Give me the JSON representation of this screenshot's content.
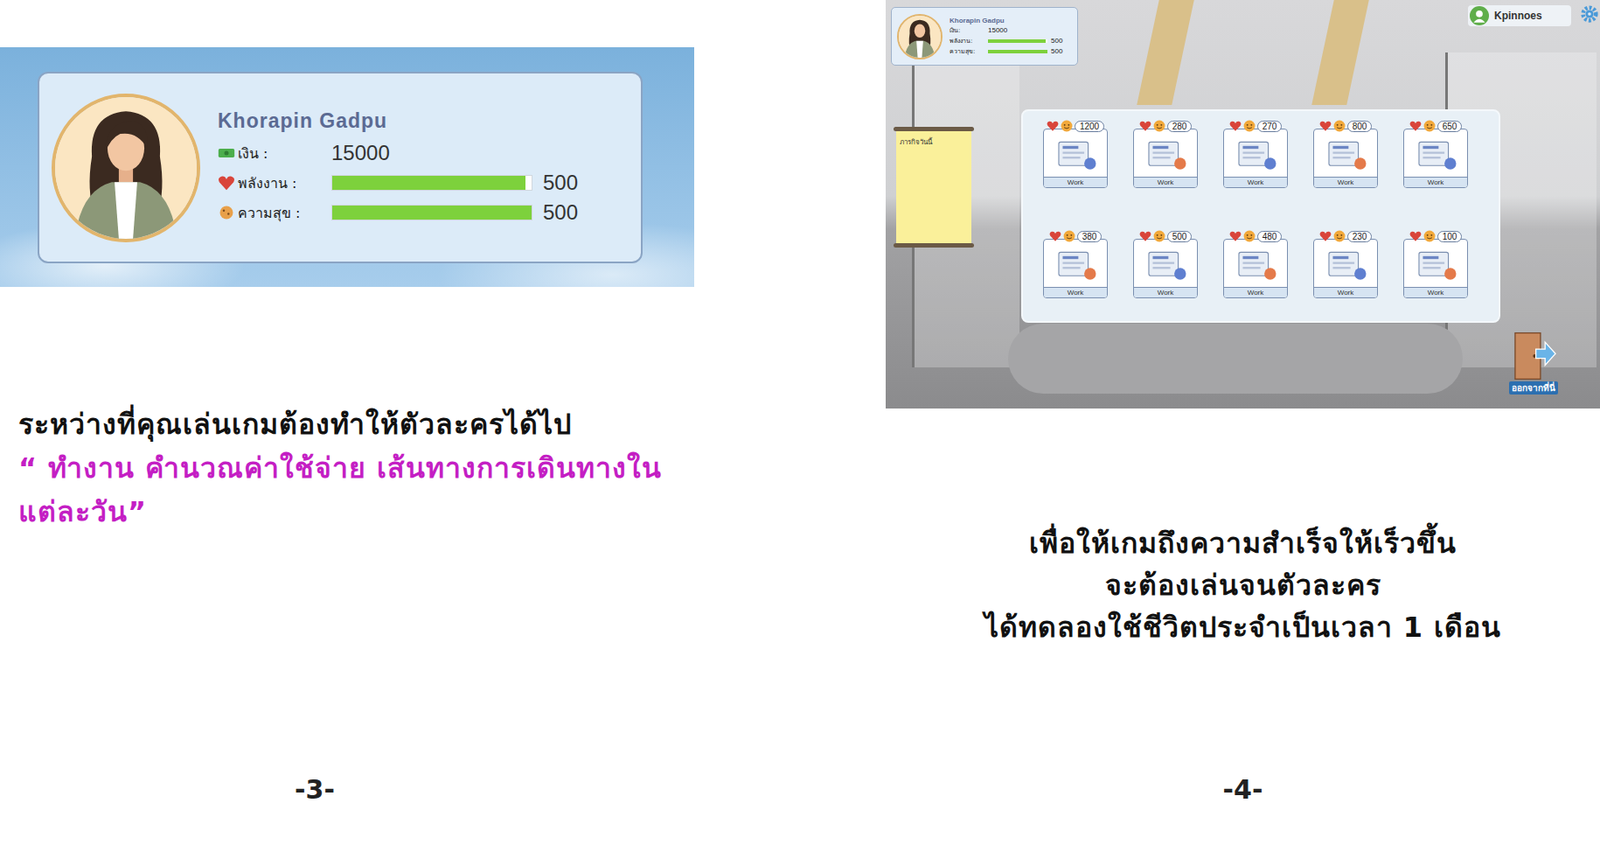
{
  "left_page": {
    "screenshot": {
      "profile": {
        "name": "Khorapin  Gadpu",
        "money_label": "เงิน :",
        "money": "15000",
        "stats": [
          {
            "kind": "energy",
            "label": "พลังงาน :",
            "value": "500",
            "level": 0.97
          },
          {
            "kind": "happiness",
            "label": "ความสุข :",
            "value": "500",
            "level": 1
          }
        ]
      }
    },
    "caption": {
      "intro": "ระหว่างที่คุณเล่นเกมต้องทำให้ตัวละครได้ไป",
      "highlight": "“ ทำงาน คำนวณค่าใช้จ่าย เส้นทางการเดินทางในแต่ละวัน”"
    },
    "page_number": "-3-"
  },
  "right_page": {
    "screenshot": {
      "profile": {
        "name": "Khorapin  Gadpu",
        "money_label": "เงิน:",
        "money": "15000",
        "stats": [
          {
            "kind": "energy",
            "label": "พลังงาน:",
            "value": "500",
            "level": 0.97
          },
          {
            "kind": "happiness",
            "label": "ความสุข:",
            "value": "500",
            "level": 1
          }
        ]
      },
      "user": "Kpinnoes",
      "tasks_title": "ภารกิจวันนี้",
      "jobs": [
        {
          "cost": "1200",
          "label": "Work"
        },
        {
          "cost": "280",
          "label": "Work"
        },
        {
          "cost": "270",
          "label": "Work"
        },
        {
          "cost": "800",
          "label": "Work"
        },
        {
          "cost": "650",
          "label": "Work"
        },
        {
          "cost": "380",
          "label": "Work"
        },
        {
          "cost": "500",
          "label": "Work"
        },
        {
          "cost": "480",
          "label": "Work"
        },
        {
          "cost": "230",
          "label": "Work"
        },
        {
          "cost": "100",
          "label": "Work"
        }
      ],
      "exit": "ออกจากที่นี่"
    },
    "caption": [
      "เพื่อให้เกมถึงความสำเร็จให้เร็วขึ้น",
      "จะต้องเล่นจนตัวละคร",
      "ได้ทดลองใช้ชีวิตประจำเป็นเวลา 1 เดือน"
    ],
    "page_number": "-4-"
  }
}
